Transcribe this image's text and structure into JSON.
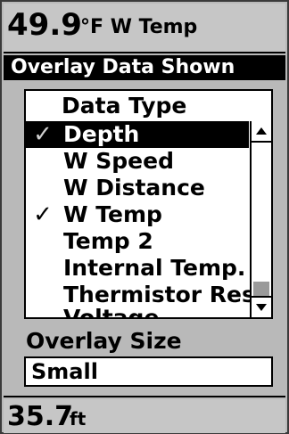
{
  "top_readout": {
    "value": "49.9",
    "unit": "°F W Temp"
  },
  "header": {
    "title": "Overlay Data Shown"
  },
  "list": {
    "header": "Data Type",
    "items": [
      {
        "label": "Depth",
        "checked": true,
        "selected": true
      },
      {
        "label": "W Speed",
        "checked": false,
        "selected": false
      },
      {
        "label": "W Distance",
        "checked": false,
        "selected": false
      },
      {
        "label": "W Temp",
        "checked": true,
        "selected": false
      },
      {
        "label": "Temp 2",
        "checked": false,
        "selected": false
      },
      {
        "label": "Internal Temp.",
        "checked": false,
        "selected": false
      },
      {
        "label": "Thermistor Resist",
        "checked": false,
        "selected": false
      },
      {
        "label": "Voltage",
        "checked": false,
        "selected": false
      }
    ],
    "check_glyph": "✓",
    "scroll_up_icon": "up-arrow",
    "scroll_down_icon": "down-arrow"
  },
  "overlay_size": {
    "label": "Overlay Size",
    "value": "Small"
  },
  "bottom_readout": {
    "value": "35.7",
    "unit": "ft"
  },
  "colors": {
    "screen_bg": "#b9b9b9",
    "panel_bg": "#ffffff",
    "selection_bg": "#000000",
    "text": "#000000"
  }
}
